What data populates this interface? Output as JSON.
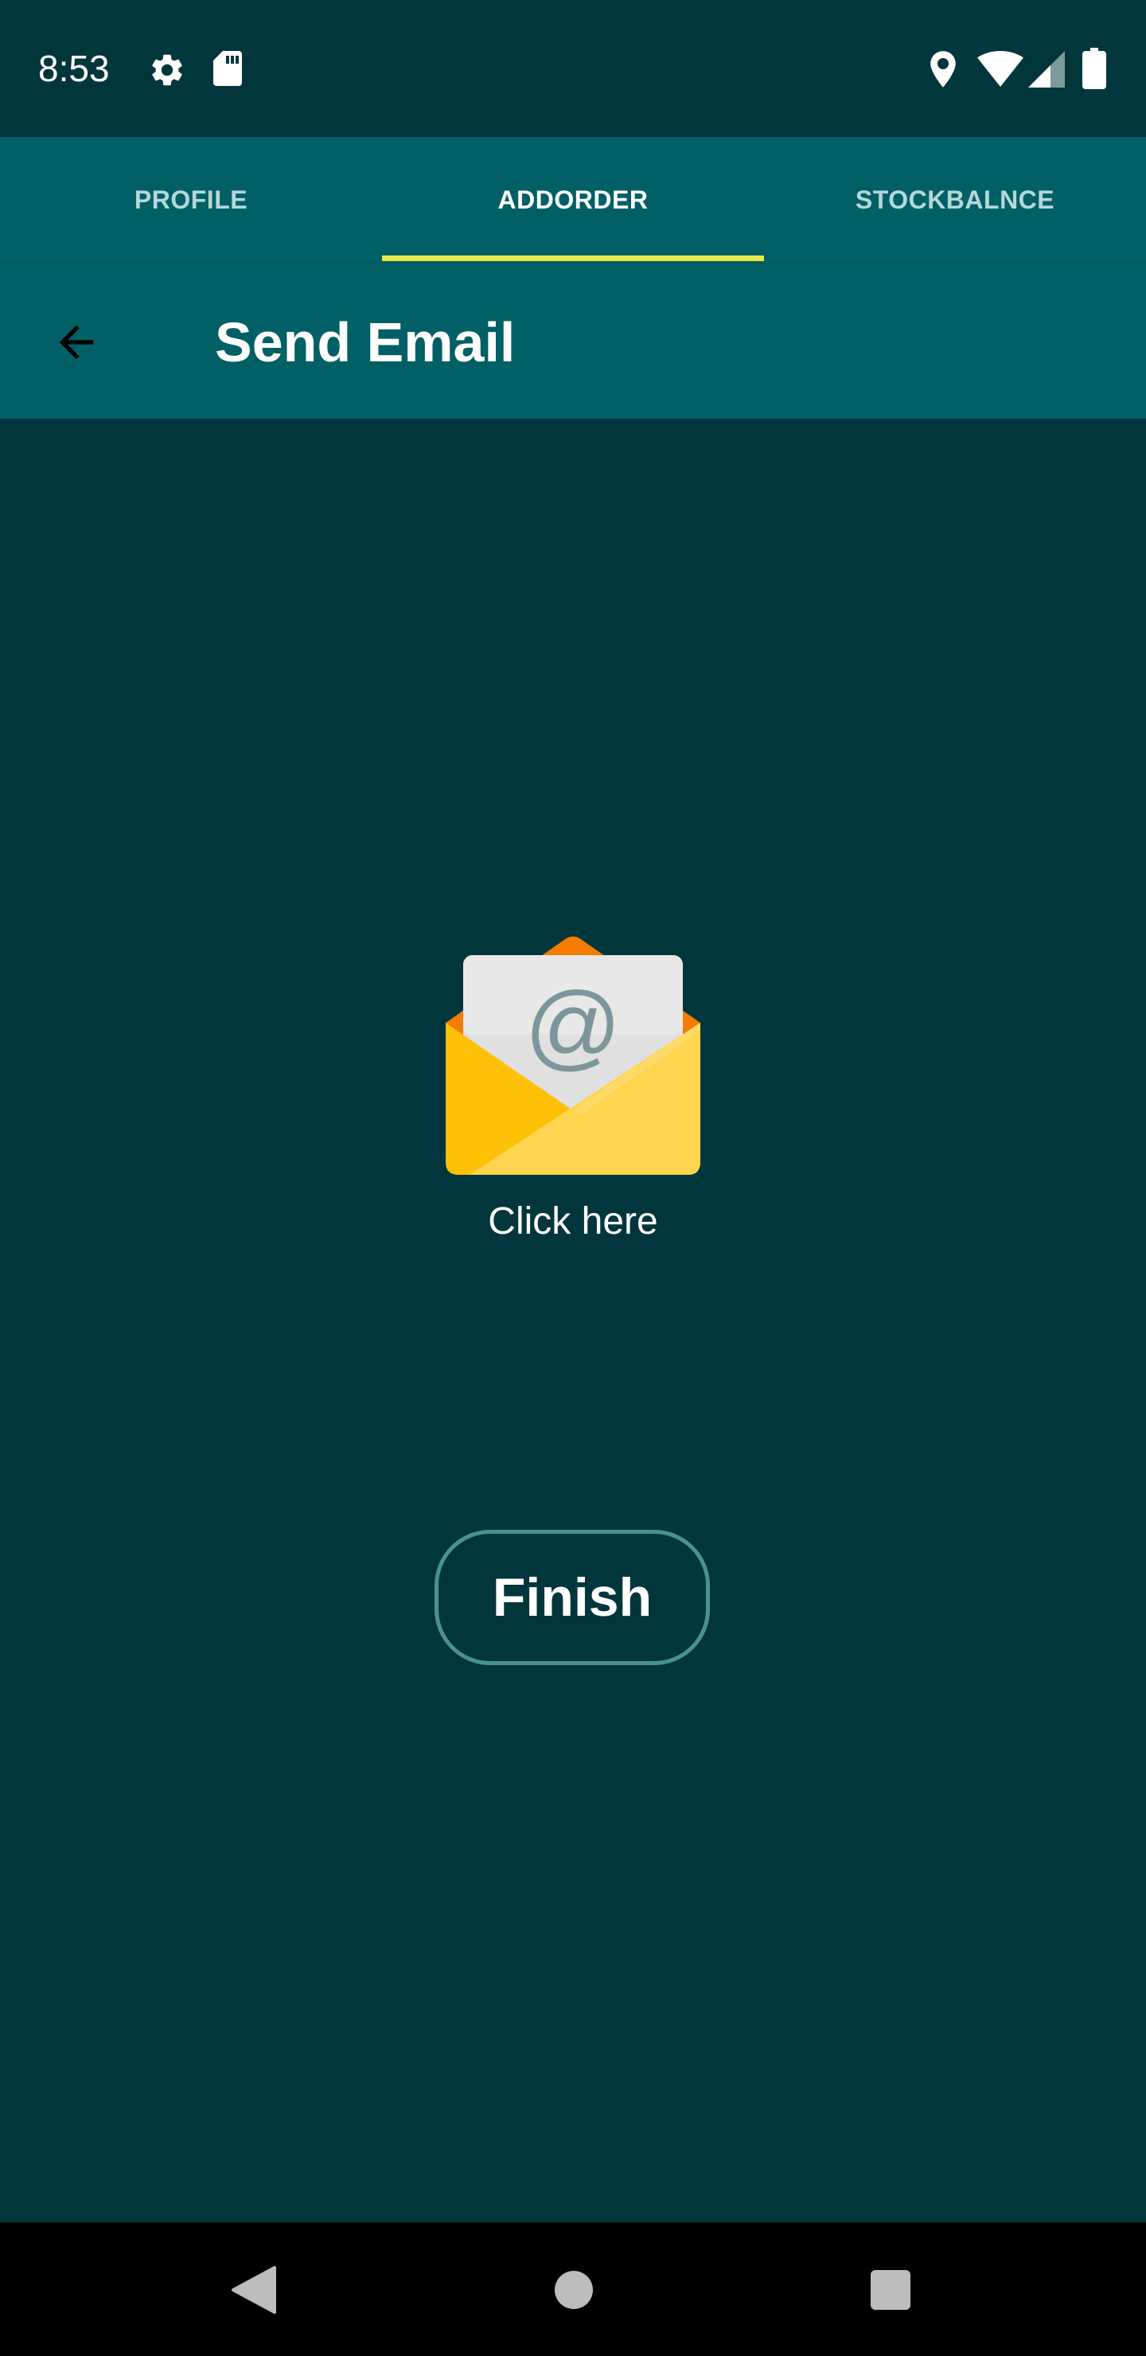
{
  "status_bar": {
    "time": "8:53",
    "left_icons": [
      "gear-icon",
      "sd-card-icon"
    ],
    "right_icons": [
      "location-icon",
      "wifi-icon",
      "signal-icon",
      "battery-icon"
    ]
  },
  "tabs": [
    {
      "label": "PROFILE",
      "active": false
    },
    {
      "label": "ADDORDER",
      "active": true
    },
    {
      "label": "STOCKBALNCE",
      "active": false
    }
  ],
  "app_bar": {
    "title": "Send Email",
    "back_icon": "arrow-left-icon"
  },
  "email_action": {
    "icon": "email-envelope-icon",
    "label": "Click here"
  },
  "finish_button": {
    "label": "Finish"
  },
  "nav_bar": {
    "buttons": [
      "back-triangle-icon",
      "home-circle-icon",
      "recents-square-icon"
    ]
  },
  "colors": {
    "background": "#02363d",
    "bar": "#006065",
    "tab_indicator": "#e9e94a",
    "button_border": "#4a9097",
    "envelope": "#ffc107"
  }
}
